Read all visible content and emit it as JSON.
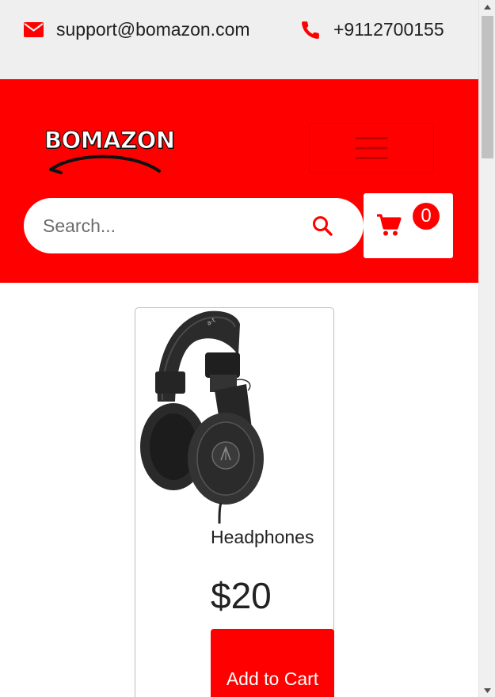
{
  "contact": {
    "email": "support@bomazon.com",
    "phone": "+9112700155"
  },
  "header": {
    "logo_text": "BOMAZON",
    "search_placeholder": "Search...",
    "cart_count": "0"
  },
  "product": {
    "name": "Headphones",
    "price": "$20",
    "add_label": "Add to Cart"
  },
  "colors": {
    "brand": "#ff0000",
    "topbar": "#efefef"
  },
  "icons": {
    "email": "envelope-icon",
    "phone": "phone-icon",
    "menu": "hamburger-icon",
    "search": "search-icon",
    "cart": "cart-icon"
  }
}
